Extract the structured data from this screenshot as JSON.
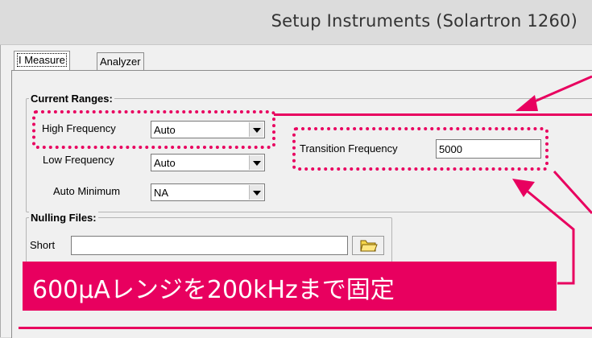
{
  "window": {
    "title": "Setup Instruments  (Solartron 1260)"
  },
  "tabs": [
    {
      "label": "I Measure"
    },
    {
      "label": "Analyzer"
    }
  ],
  "current_ranges": {
    "title": "Current Ranges:",
    "high_frequency": {
      "label": "High Frequency",
      "value": "Auto"
    },
    "low_frequency": {
      "label": "Low Frequency",
      "value": "Auto"
    },
    "auto_minimum": {
      "label": "Auto Minimum",
      "value": "NA"
    },
    "transition_frequency": {
      "label": "Transition Frequency",
      "value": "5000"
    }
  },
  "nulling_files": {
    "title": "Nulling Files:",
    "short": {
      "label": "Short",
      "value": ""
    }
  },
  "annotation": {
    "text": "600μAレンジを200kHzまで固定",
    "color": "#e8005f"
  }
}
